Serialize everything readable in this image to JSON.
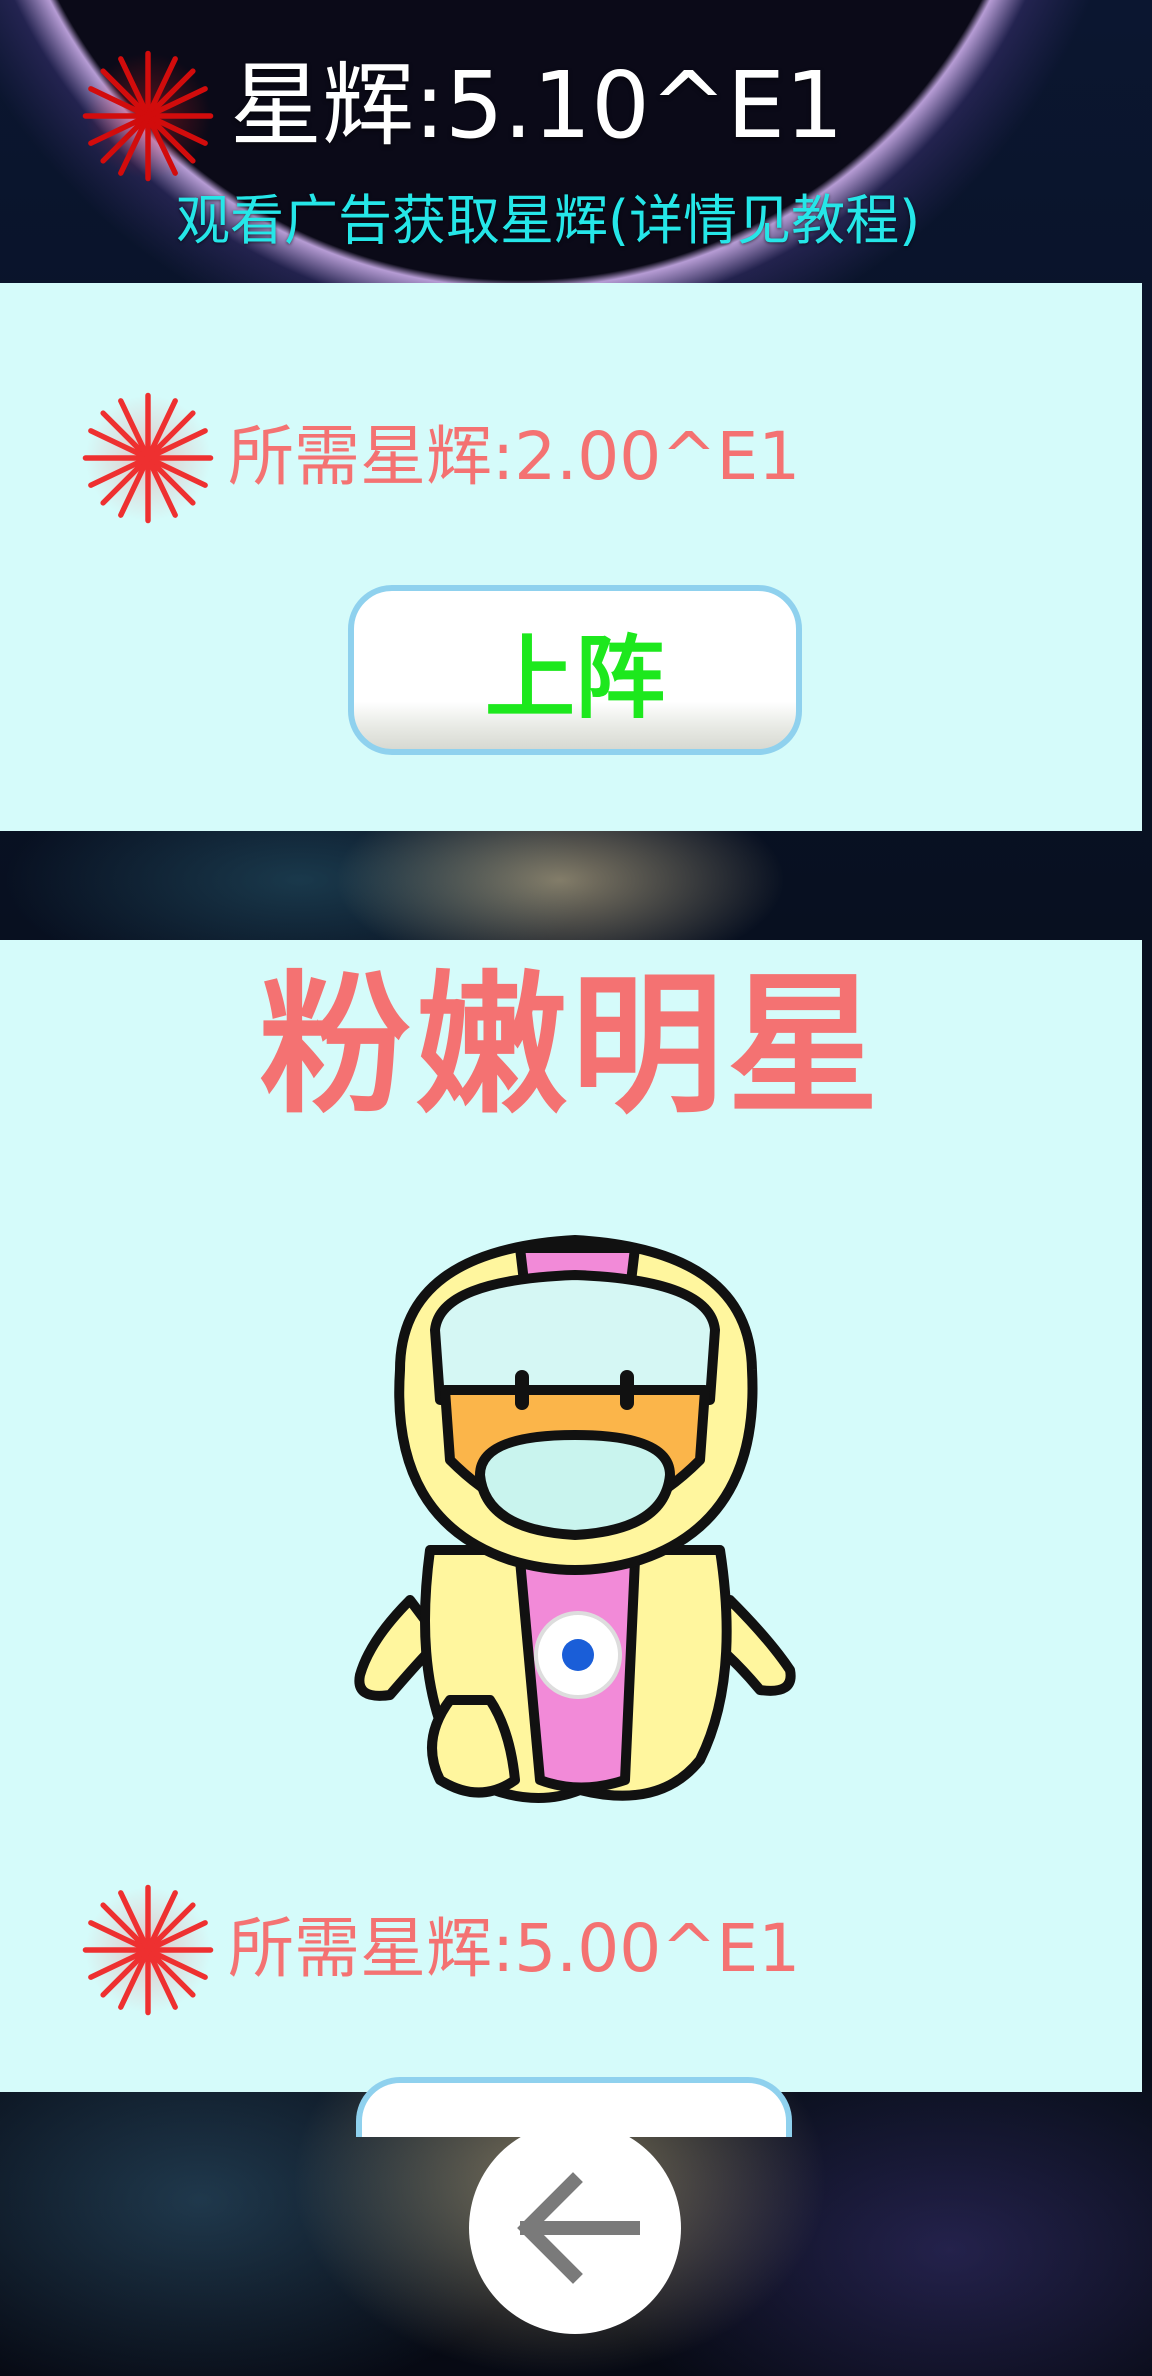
{
  "header": {
    "currency_label": "星辉",
    "currency_value": "星辉:5.10^E1",
    "ad_link": "观看广告获取星辉(详情见教程)"
  },
  "cards": [
    {
      "cost_label": "所需星辉:2.00^E1",
      "button_label": "上阵"
    },
    {
      "name": "粉嫩明星",
      "cost_label": "所需星辉:5.00^E1"
    }
  ],
  "navigation": {
    "back_icon": "arrow-left-icon"
  },
  "colors": {
    "panel": "#d5fbfa",
    "cost_text": "#f47272",
    "title_text": "#f47272",
    "button_text": "#1de81d",
    "ad_link_text": "#25e6e8"
  }
}
